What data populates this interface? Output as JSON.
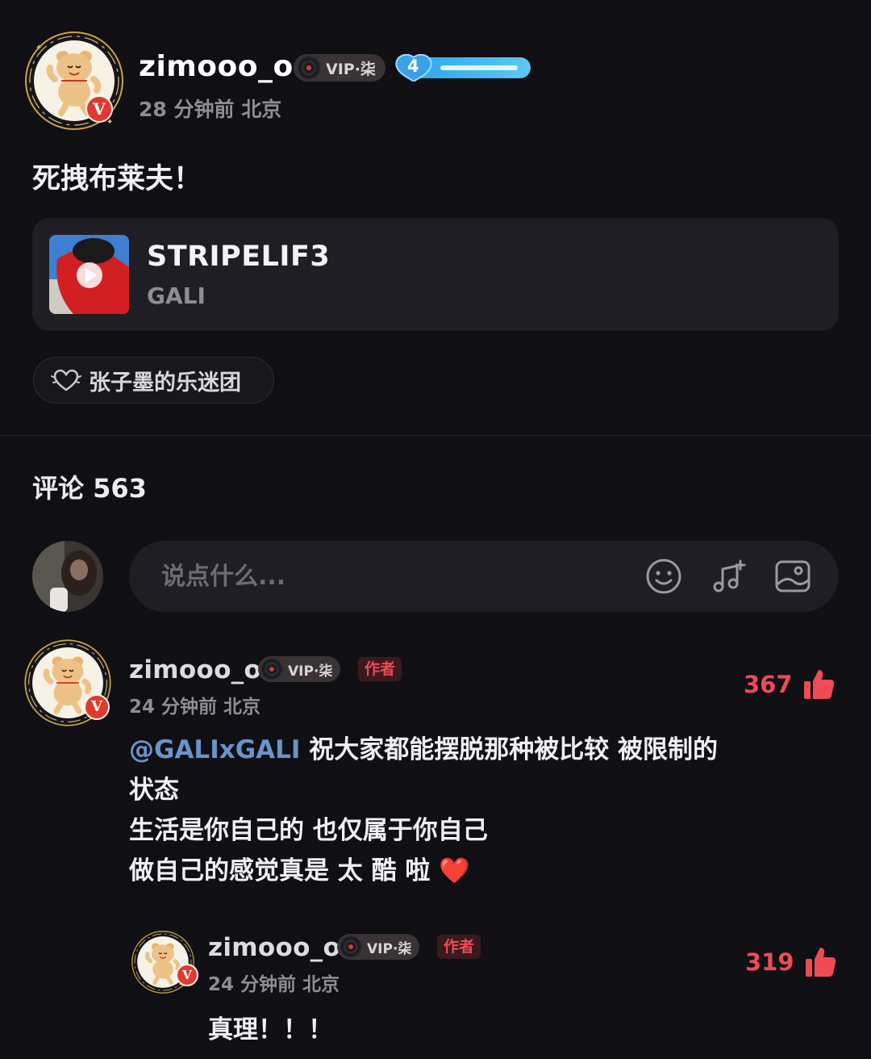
{
  "post": {
    "author": "zimooo_o",
    "vip_label": "VIP·柒",
    "fan_level": "4",
    "time_location": "28 分钟前 北京",
    "text": "死拽布莱夫！"
  },
  "song": {
    "title": "STRIPELIF3",
    "artist": "GALI"
  },
  "fan_club": {
    "label": "张子墨的乐迷团"
  },
  "comments_section": {
    "heading": "评论 563",
    "input_placeholder": "说点什么..."
  },
  "comments": [
    {
      "author": "zimooo_o",
      "vip_label": "VIP·柒",
      "author_tag": "作者",
      "time_location": "24 分钟前 北京",
      "likes": "367",
      "mention": "@GALIxGALI",
      "lines": [
        " 祝大家都能摆脱那种被比较 被限制的",
        "状态",
        "生活是你自己的 也仅属于你自己",
        "做自己的感觉真是 太 酷 啦"
      ],
      "emoji": "❤️"
    },
    {
      "author": "zimooo_o",
      "vip_label": "VIP·柒",
      "author_tag": "作者",
      "time_location": "24 分钟前 北京",
      "likes": "319",
      "text": "真理！！！"
    }
  ],
  "colors": {
    "background": "#0f0f14",
    "card": "#1e1e24",
    "accent_red": "#ef4b55",
    "mention_blue": "#6a94c8",
    "fan_badge_blue": "#3cb7f0"
  },
  "icons": [
    "verified-v-icon",
    "vinyl-record-icon",
    "heart-badge-icon",
    "play-icon",
    "fan-club-heart-icon",
    "emoji-icon",
    "music-note-add-icon",
    "image-icon",
    "thumbs-up-icon"
  ]
}
